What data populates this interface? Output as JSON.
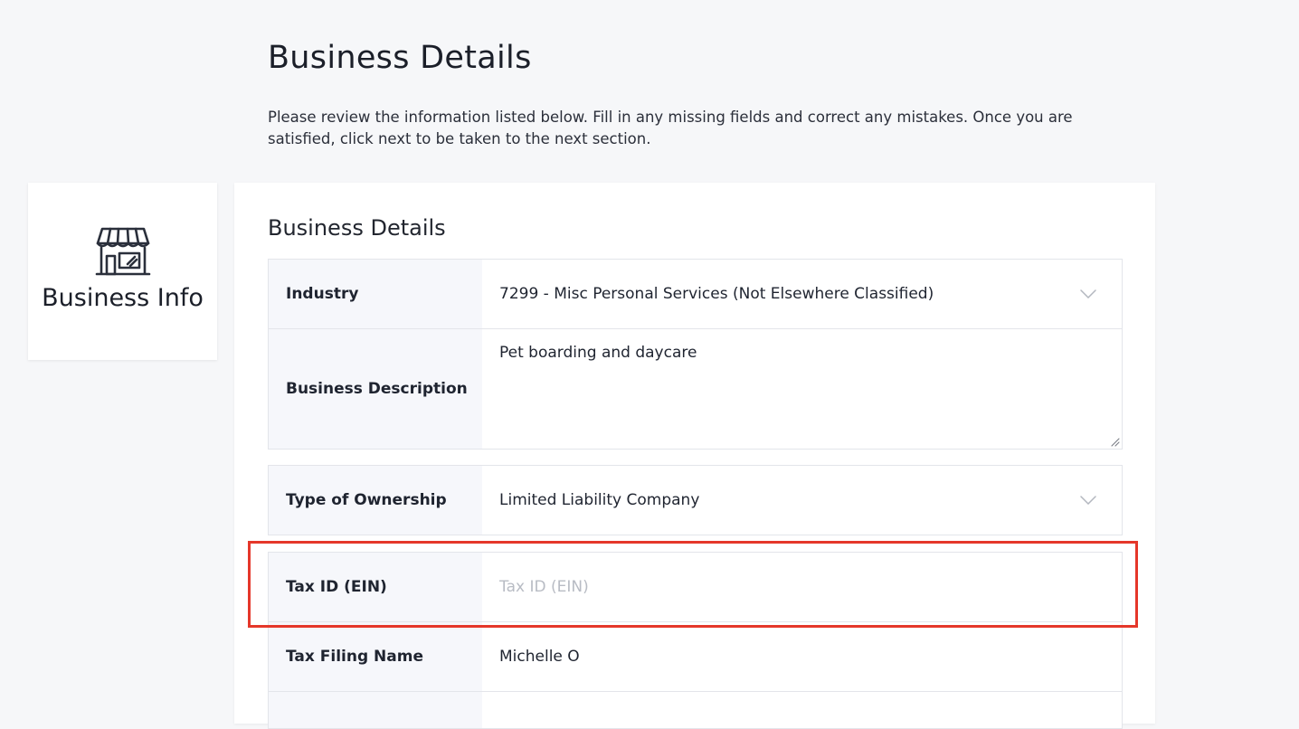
{
  "page": {
    "title": "Business Details",
    "intro": "Please review the information listed below. Fill in any missing fields and correct any mistakes. Once you are satisfied, click next to be taken to the next section."
  },
  "sidebar": {
    "icon": "storefront-icon",
    "label": "Business Info"
  },
  "section": {
    "title": "Business Details"
  },
  "fields": {
    "industry": {
      "label": "Industry",
      "value": "7299 - Misc Personal Services (Not Elsewhere Classified)"
    },
    "business_description": {
      "label": "Business Description",
      "value": "Pet boarding and daycare"
    },
    "type_of_ownership": {
      "label": "Type of Ownership",
      "value": "Limited Liability Company"
    },
    "tax_id": {
      "label": "Tax ID (EIN)",
      "value": "",
      "placeholder": "Tax ID (EIN)"
    },
    "tax_filing_name": {
      "label": "Tax Filing Name",
      "value": "Michelle O"
    },
    "next_row": {
      "label": "",
      "value": ""
    }
  },
  "colors": {
    "background": "#f6f7f9",
    "label_background": "#f6f7fb",
    "highlight": "#e5372a",
    "placeholder": "#b8bcc4"
  }
}
